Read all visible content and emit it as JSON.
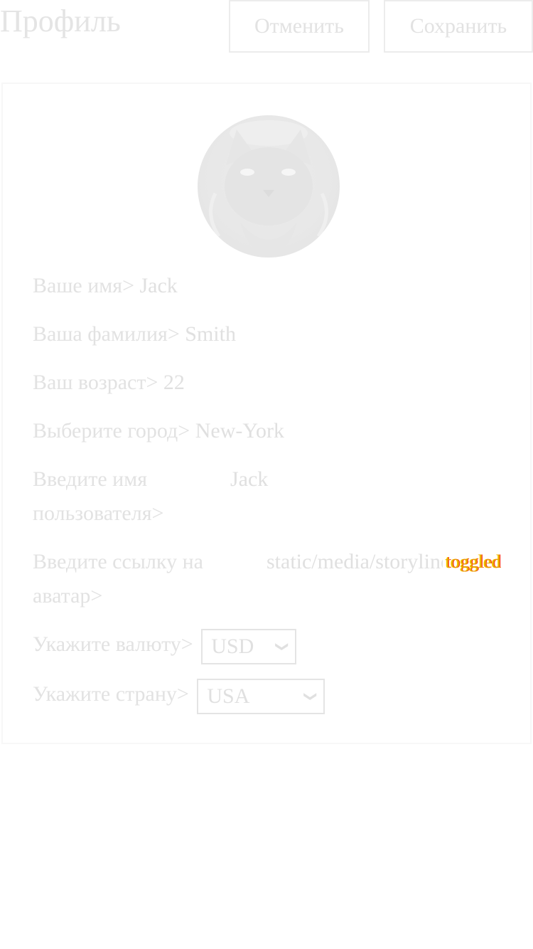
{
  "header": {
    "title": "Профиль",
    "cancel_label": "Отменить",
    "save_label": "Сохранить"
  },
  "profile": {
    "avatar_icon": "cat-avatar",
    "fields": {
      "first_name": {
        "label": "Ваше имя>",
        "value": "Jack"
      },
      "last_name": {
        "label": "Ваша фамилия>",
        "value": "Smith"
      },
      "age": {
        "label": "Ваш возраст>",
        "value": "22"
      },
      "city": {
        "label": "Выберите город>",
        "value": "New-York"
      },
      "username": {
        "label": "Введите имя пользователя>",
        "value": "Jack"
      },
      "avatar_link": {
        "label": "Введите ссылку на аватар>",
        "value": "static/media/storyline.....",
        "overlay": "toggled"
      },
      "currency": {
        "label": "Укажите валюту>",
        "value": "USD"
      },
      "country": {
        "label": "Укажите страну>",
        "value": "USA"
      }
    }
  }
}
